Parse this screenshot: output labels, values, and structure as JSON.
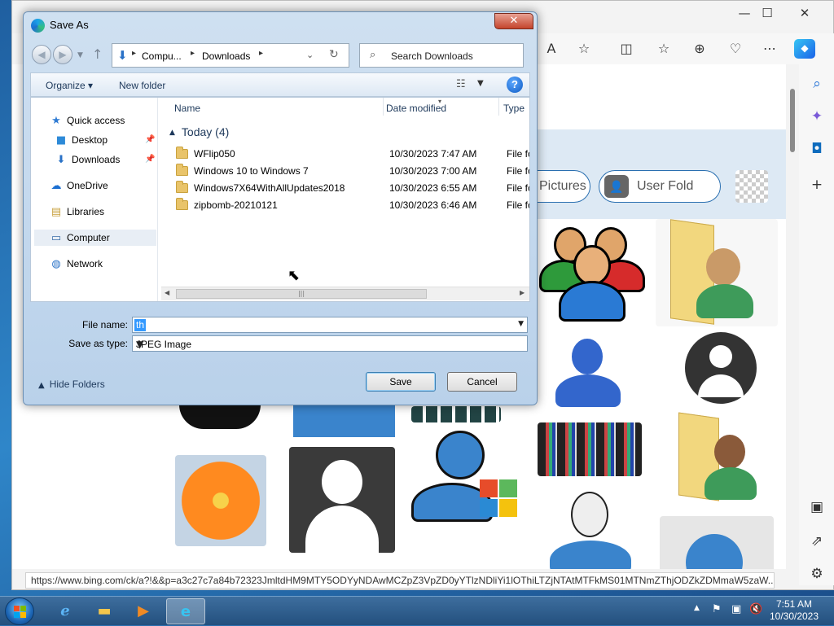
{
  "dialog": {
    "title": "Save As",
    "close_glyph": "✕",
    "nav": {
      "back": "◀",
      "forward": "▶",
      "dropdown": "▼",
      "up": "↑"
    },
    "address": {
      "crumbs": [
        "Compu...",
        "Downloads"
      ],
      "separator": "▸",
      "dropdown": "⌄",
      "refresh": "↻"
    },
    "search": {
      "placeholder": "Search Downloads",
      "icon": "⌕"
    },
    "toolbar": {
      "organize_label": "Organize ▾",
      "new_folder_label": "New folder",
      "view_icon": "☷",
      "view_dropdown": "▼",
      "help_label": "?"
    },
    "nav_pane": {
      "items": [
        {
          "label": "Quick access",
          "icon": "★",
          "color": "#2f7bd3"
        },
        {
          "label": "Desktop",
          "icon": "■",
          "color": "#2d8ad8"
        },
        {
          "label": "Downloads",
          "icon": "⬇",
          "color": "#2a72c7"
        },
        {
          "label": "OneDrive",
          "icon": "☁",
          "color": "#1c6fd1"
        },
        {
          "label": "Libraries",
          "icon": "▤",
          "color": "#c8a03e"
        },
        {
          "label": "Computer",
          "icon": "▭",
          "color": "#3a6ea8"
        },
        {
          "label": "Network",
          "icon": "◍",
          "color": "#2a72c7"
        }
      ],
      "pin_glyph": "📌"
    },
    "columns": {
      "name": "Name",
      "date": "Date modified",
      "type": "Type",
      "sort_glyph": "▾"
    },
    "group": {
      "label": "Today (4)",
      "caret": "▲"
    },
    "files": [
      {
        "name": "WFlip050",
        "date": "10/30/2023 7:47 AM",
        "type": "File fol"
      },
      {
        "name": "Windows 10 to Windows 7",
        "date": "10/30/2023 7:00 AM",
        "type": "File fol"
      },
      {
        "name": "Windows7X64WithAllUpdates2018",
        "date": "10/30/2023 6:55 AM",
        "type": "File fol"
      },
      {
        "name": "zipbomb-20210121",
        "date": "10/30/2023 6:46 AM",
        "type": "File fol"
      }
    ],
    "hscroll": {
      "left": "◀",
      "right": "▶",
      "grip": "|||"
    },
    "cursor": "⬉",
    "file_name_label": "File name:",
    "file_name_value": "th",
    "save_type_label": "Save as type:",
    "save_type_value": "JPEG Image",
    "dropdown_glyph": "▼",
    "hide_folders_label": "Hide Folders",
    "hide_folders_glyph": "▲",
    "save_label": "Save",
    "cancel_label": "Cancel"
  },
  "browser": {
    "toolbar_icons": [
      "A",
      "☆",
      "◫",
      "☆",
      "⊕",
      "♡",
      "⋯"
    ],
    "window_controls": [
      "—",
      "☐",
      "✕"
    ],
    "chips": [
      "Pictures",
      "User Fold"
    ],
    "chip_next": "❯",
    "rail_icons": [
      "⌕",
      "✦",
      "◘",
      "+",
      "▣",
      "⇗",
      "⚙"
    ],
    "status_url": "https://www.bing.com/ck/a?!&&p=a3c27c7a84b72323JmltdHM9MTY5ODYyNDAwMCZpZ3VpZD0yYTlzNDliYi1lOThiLTZjNTAtMTFkMS01MTNmZThjODZkZDMmaW5zaW..."
  },
  "taskbar": {
    "apps": [
      "e",
      "▬",
      "▶",
      "e"
    ],
    "tray_icons": [
      "▲",
      "⚑",
      "▣",
      "🔇"
    ],
    "time": "7:51 AM",
    "date": "10/30/2023"
  },
  "colors": {
    "accent": "#2a6fb0",
    "selection": "#3399ff",
    "folder": "#e9c46a",
    "close_red": "#c4442c"
  }
}
